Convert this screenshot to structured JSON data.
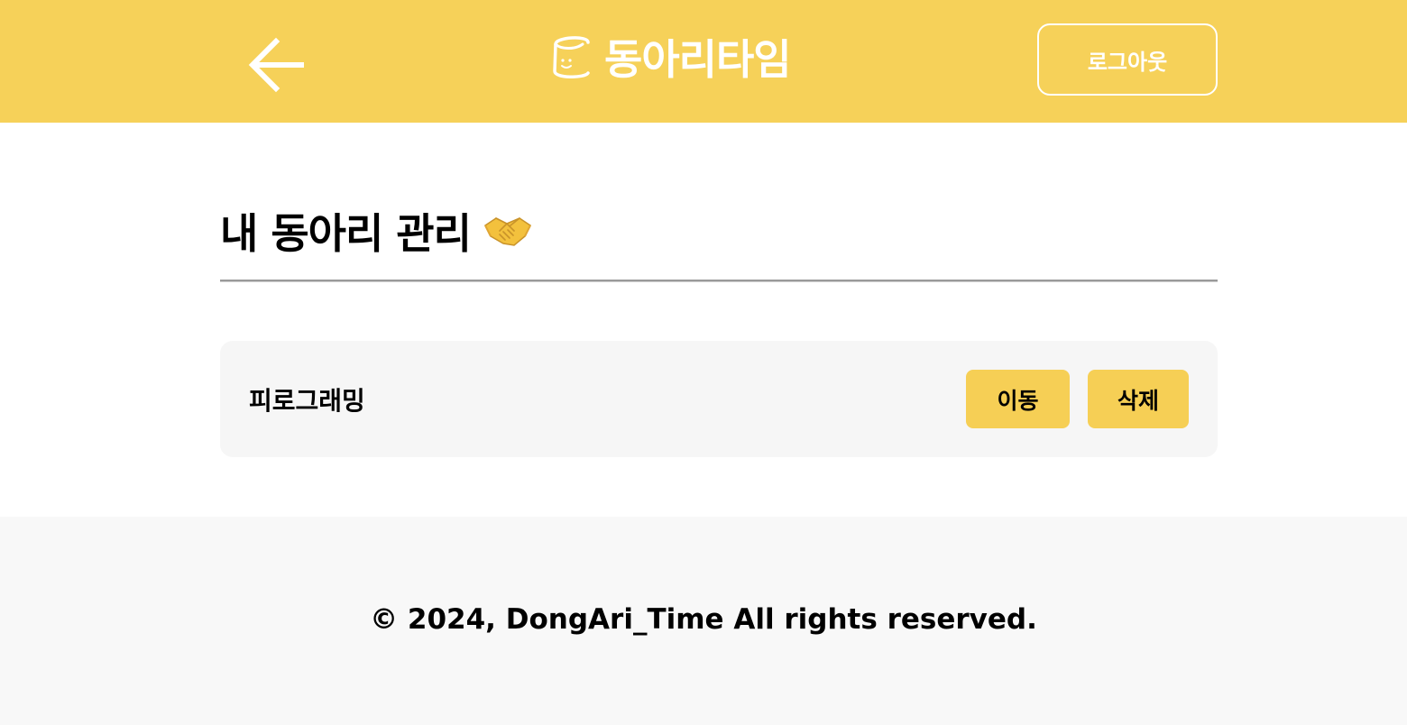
{
  "header": {
    "brand_name": "동아리타임",
    "logout_label": "로그아웃",
    "colors": {
      "background": "#f6d159",
      "foreground": "#ffffff"
    },
    "icons": {
      "back": "arrow-left-icon",
      "logo": "marshmallow-face-logo"
    }
  },
  "main": {
    "title": "내 동아리 관리",
    "title_icon": "handshake-icon",
    "clubs": [
      {
        "name": "피로그래밍",
        "move_label": "이동",
        "delete_label": "삭제"
      }
    ],
    "colors": {
      "button": "#f6cf55",
      "card": "#f6f6f6"
    }
  },
  "footer": {
    "copyright": "© 2024, DongAri_Time All rights reserved.",
    "colors": {
      "background": "#f8f8f8"
    }
  }
}
